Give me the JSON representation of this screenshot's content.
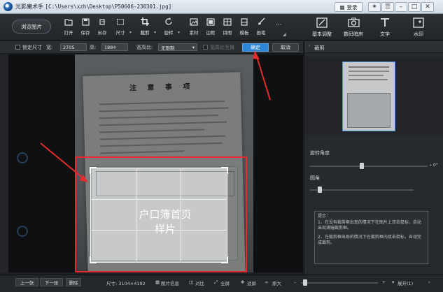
{
  "window": {
    "app_name": "光影魔术手",
    "file_path": "[C:\\Users\\xzh\\Desktop\\P50606-230301.jpg]",
    "login_label": "登录"
  },
  "toolbar": {
    "browse_label": "浏览图片",
    "tools": [
      {
        "label": "打开",
        "icon": "folder-open-icon"
      },
      {
        "label": "保存",
        "icon": "save-icon"
      },
      {
        "label": "另存",
        "icon": "save-as-icon"
      },
      {
        "label": "尺寸",
        "icon": "resize-icon"
      },
      {
        "label": "裁剪",
        "icon": "crop-icon"
      },
      {
        "label": "旋转",
        "icon": "rotate-icon"
      },
      {
        "label": "素材",
        "icon": "material-icon"
      },
      {
        "label": "边框",
        "icon": "frame-icon"
      },
      {
        "label": "拼图",
        "icon": "collage-icon"
      },
      {
        "label": "模板",
        "icon": "template-icon"
      },
      {
        "label": "画笔",
        "icon": "brush-icon"
      }
    ],
    "big_tools": [
      {
        "label": "基本调整",
        "icon": "adjust-icon"
      },
      {
        "label": "数码暗房",
        "icon": "camera-icon"
      },
      {
        "label": "文字",
        "icon": "text-icon"
      },
      {
        "label": "水印",
        "icon": "watermark-icon"
      }
    ]
  },
  "crop_bar": {
    "lock_size_label": "锁定尺寸",
    "width_label": "宽:",
    "width_value": "2705",
    "height_label": "高:",
    "height_value": "1884",
    "ratio_label": "宽高比:",
    "ratio_value": "无限制",
    "swap_label": "宽高比互换",
    "confirm_label": "确定",
    "cancel_label": "取消"
  },
  "canvas": {
    "doc_title": "注 意 事 项",
    "booklet_line1": "户口簿首页",
    "booklet_line2": "样片"
  },
  "right_panel": {
    "section_title": "裁剪",
    "rotate_label": "旋转角度",
    "rotate_value": "0°",
    "corner_label": "圆角",
    "hint_title": "提示：",
    "hint_line1": "1、在没有裁剪框出现的情况下在图片上双击鼠标，自动出现满幅裁剪框。",
    "hint_line2": "2、在裁剪框出现的情况下在裁剪框内双击鼠标，自动完成裁剪。"
  },
  "status_bar": {
    "prev_label": "上一张",
    "next_label": "下一张",
    "delete_label": "删除",
    "size_text": "尺寸: 3104×4192",
    "info_label": "图片信息",
    "compare_label": "对比",
    "fullscreen_label": "全屏",
    "fit_label": "适屏",
    "original_label": "原大",
    "expand_label": "展开(1)"
  },
  "colors": {
    "accent": "#2f86d6",
    "annotation_red": "#e52c2c"
  }
}
